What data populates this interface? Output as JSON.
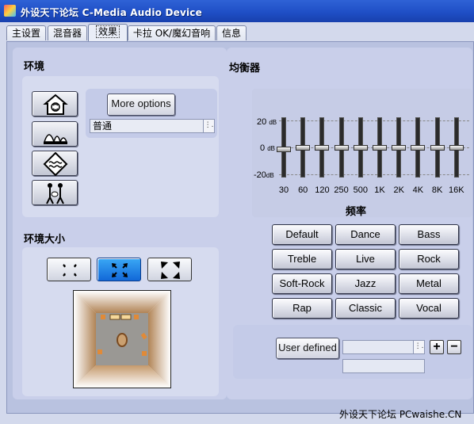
{
  "window": {
    "title": "外设天下论坛 C-Media Audio Device"
  },
  "tabs": [
    {
      "label": "主设置"
    },
    {
      "label": "混音器"
    },
    {
      "label": "效果"
    },
    {
      "label": "卡拉 OK/魔幻音响"
    },
    {
      "label": "信息"
    }
  ],
  "environment": {
    "title": "环境",
    "icons": [
      "home-icon",
      "opera-house-icon",
      "water-icon",
      "guitarist-icon"
    ],
    "more_options_label": "More options",
    "preset_value": "普通"
  },
  "env_size": {
    "title": "环境大小",
    "buttons": [
      "small-room-icon",
      "medium-room-icon",
      "large-room-icon"
    ],
    "selected": 1
  },
  "equalizer": {
    "title": "均衡器",
    "db_labels": {
      "top": "20",
      "mid": "0",
      "bottom": "-20",
      "unit": "dB"
    },
    "freq_axis_label": "频率",
    "bands": [
      {
        "freq": "30",
        "gain": -1
      },
      {
        "freq": "60",
        "gain": 0
      },
      {
        "freq": "120",
        "gain": 0
      },
      {
        "freq": "250",
        "gain": 0
      },
      {
        "freq": "500",
        "gain": 0
      },
      {
        "freq": "1K",
        "gain": 0
      },
      {
        "freq": "2K",
        "gain": 0
      },
      {
        "freq": "4K",
        "gain": 0
      },
      {
        "freq": "8K",
        "gain": 0
      },
      {
        "freq": "16K",
        "gain": 0
      }
    ],
    "presets": [
      "Default",
      "Dance",
      "Bass",
      "Treble",
      "Live",
      "Rock",
      "Soft-Rock",
      "Jazz",
      "Metal",
      "Rap",
      "Classic",
      "Vocal"
    ],
    "user_defined_label": "User defined",
    "user_defined_value": "",
    "user_defined_name": "",
    "add_label": "+",
    "remove_label": "−"
  },
  "watermark": "外设天下论坛 PCwaishe.CN"
}
